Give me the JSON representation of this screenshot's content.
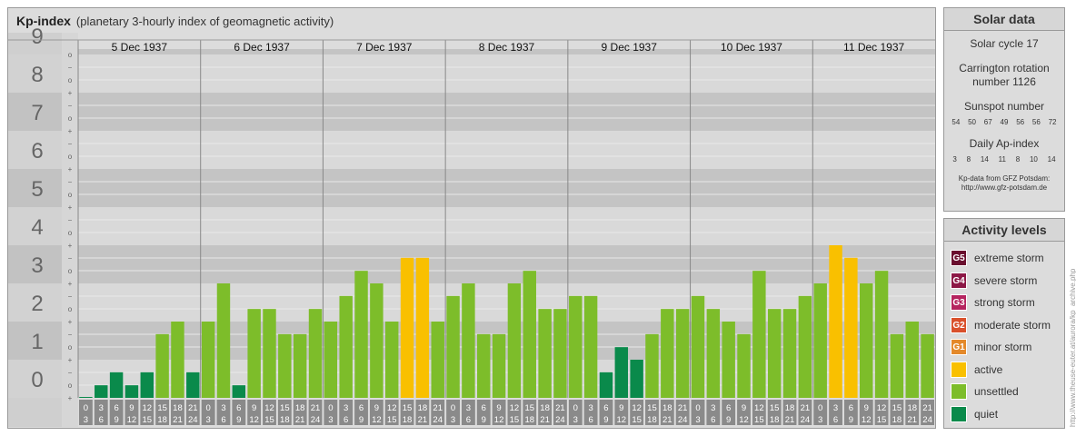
{
  "header": {
    "title": "Kp-index",
    "subtitle": "(planetary 3-hourly index of geomagnetic activity)"
  },
  "chart_data": {
    "type": "bar",
    "days": [
      "5 Dec 1937",
      "6 Dec 1937",
      "7 Dec 1937",
      "8 Dec 1937",
      "9 Dec 1937",
      "10 Dec 1937",
      "11 Dec 1937"
    ],
    "hour_starts": [
      "0",
      "3",
      "6",
      "9",
      "12",
      "15",
      "18",
      "21"
    ],
    "hour_ends": [
      "3",
      "6",
      "9",
      "12",
      "15",
      "18",
      "21",
      "24"
    ],
    "y_labels": [
      "0",
      "1",
      "2",
      "3",
      "4",
      "5",
      "6",
      "7",
      "8",
      "9"
    ],
    "sub_marks": [
      "+",
      "o",
      "−"
    ],
    "ylim": [
      0,
      9
    ],
    "values": [
      0.0,
      0.33,
      0.67,
      0.33,
      0.67,
      1.67,
      2.0,
      0.67,
      2.0,
      3.0,
      0.33,
      2.33,
      2.33,
      1.67,
      1.67,
      2.33,
      2.0,
      2.67,
      3.33,
      3.0,
      2.0,
      3.67,
      3.67,
      2.0,
      2.67,
      3.0,
      1.67,
      1.67,
      3.0,
      3.33,
      2.33,
      2.33,
      2.67,
      2.67,
      0.67,
      1.33,
      1.0,
      1.67,
      2.33,
      2.33,
      2.67,
      2.33,
      2.0,
      1.67,
      3.33,
      2.33,
      2.33,
      2.67,
      3.0,
      4.0,
      3.67,
      3.0,
      3.33,
      1.67,
      2.0,
      1.67
    ],
    "colors": {
      "quiet": "#0a8a4b",
      "unsettled": "#7dbd2a",
      "active": "#f9c000",
      "band_dark": "#c4c4c4",
      "band_light": "#d9d9d9"
    }
  },
  "solar": {
    "title": "Solar data",
    "cycle": "Solar cycle 17",
    "carrington_line1": "Carrington rotation",
    "carrington_line2": "number 1126",
    "sunspot_title": "Sunspot number",
    "sunspot_values": [
      "54",
      "50",
      "67",
      "49",
      "56",
      "56",
      "72"
    ],
    "ap_title": "Daily Ap-index",
    "ap_values": [
      "3",
      "8",
      "14",
      "11",
      "8",
      "10",
      "14"
    ],
    "source_line1": "Kp-data from GFZ Potsdam:",
    "source_line2": "http://www.gfz-potsdam.de"
  },
  "levels": {
    "title": "Activity levels",
    "items": [
      {
        "code": "G5",
        "label": "extreme storm",
        "color": "#6a0f2e"
      },
      {
        "code": "G4",
        "label": "severe storm",
        "color": "#8c1846"
      },
      {
        "code": "G3",
        "label": "strong storm",
        "color": "#b5245f"
      },
      {
        "code": "G2",
        "label": "moderate storm",
        "color": "#d9502b"
      },
      {
        "code": "G1",
        "label": "minor storm",
        "color": "#e4892a"
      },
      {
        "code": "",
        "label": "active",
        "color": "#f9c000"
      },
      {
        "code": "",
        "label": "unsettled",
        "color": "#7dbd2a"
      },
      {
        "code": "",
        "label": "quiet",
        "color": "#0a8a4b"
      }
    ]
  },
  "watermark": "http://www.theuse-euter.at/aurora/kp_archive.php"
}
